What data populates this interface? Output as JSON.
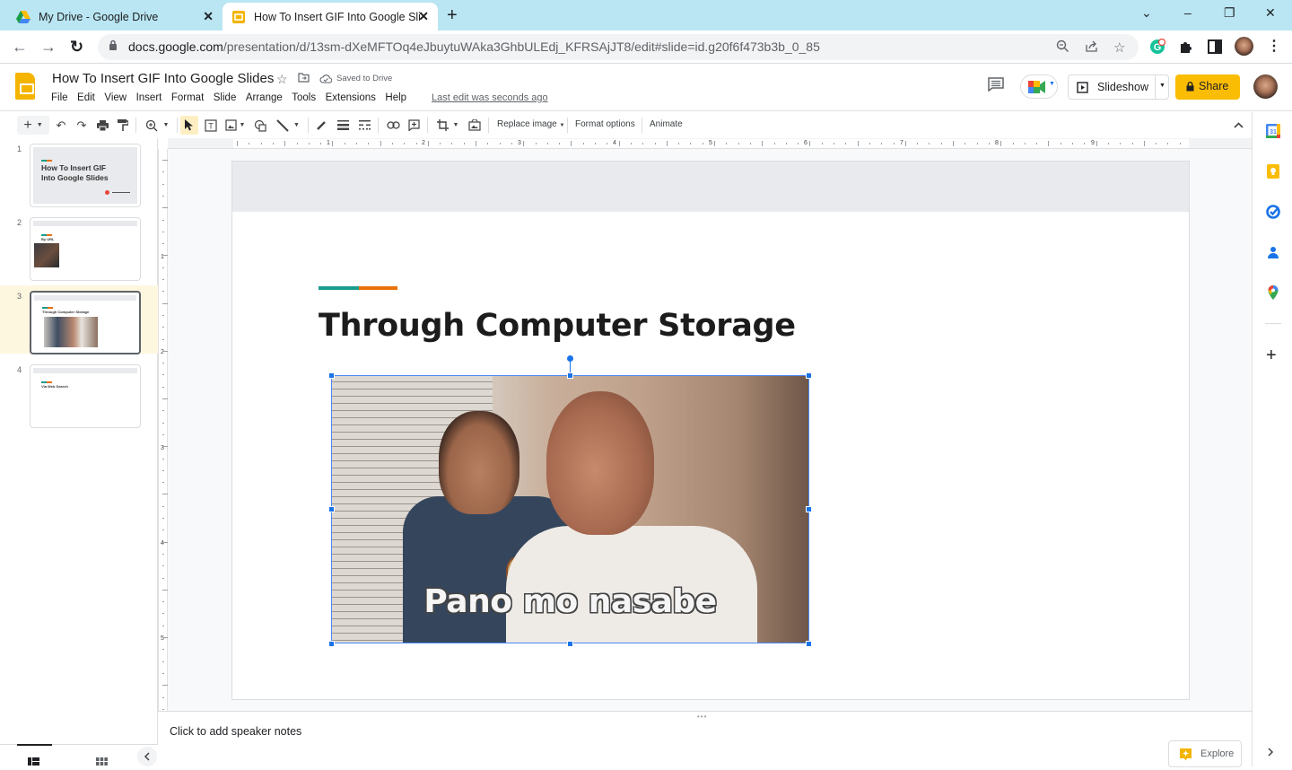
{
  "browser": {
    "tabs": [
      {
        "title": "My Drive - Google Drive",
        "icon": "google-drive-icon",
        "active": false
      },
      {
        "title": "How To Insert GIF Into Google Sli",
        "icon": "google-slides-icon",
        "active": true
      }
    ],
    "new_tab_glyph": "+",
    "url_host": "docs.google.com",
    "url_path": "/presentation/d/13sm-dXeMFTOq4eJbuytuWAka3GhbULEdj_KFRSAjJT8/edit#slide=id.g20f6f473b3b_0_85",
    "window_controls": {
      "tab_search": "⌄",
      "minimize": "–",
      "restore": "❐",
      "close": "✕"
    }
  },
  "docs": {
    "title": "How To Insert GIF Into Google Slides",
    "saved_status": "Saved to Drive",
    "menu": [
      "File",
      "Edit",
      "View",
      "Insert",
      "Format",
      "Slide",
      "Arrange",
      "Tools",
      "Extensions",
      "Help"
    ],
    "last_edit": "Last edit was seconds ago",
    "slideshow_label": "Slideshow",
    "share_label": "Share",
    "accent_color": "#fbbc04"
  },
  "toolbar": {
    "replace_image": "Replace image",
    "format_options": "Format options",
    "animate": "Animate"
  },
  "ruler": {
    "horizontal": [
      "1",
      "2",
      "3",
      "4",
      "5",
      "6",
      "7",
      "8",
      "9"
    ],
    "vertical": [
      "1",
      "2",
      "3",
      "4",
      "5"
    ]
  },
  "filmstrip": {
    "slides": [
      {
        "number": "1",
        "title": "How To Insert GIF Into Google Slides"
      },
      {
        "number": "2",
        "title": "By URL"
      },
      {
        "number": "3",
        "title": "Through Computer Storage",
        "selected": true
      },
      {
        "number": "4",
        "title": "Via Web Search"
      }
    ]
  },
  "slide": {
    "title": "Through Computer Storage",
    "image_caption": "Pano mo nasabe",
    "accent_colors": [
      "#1a9c8c",
      "#e8710a"
    ]
  },
  "notes": {
    "placeholder": "Click to add speaker notes"
  },
  "explore": {
    "label": "Explore"
  }
}
